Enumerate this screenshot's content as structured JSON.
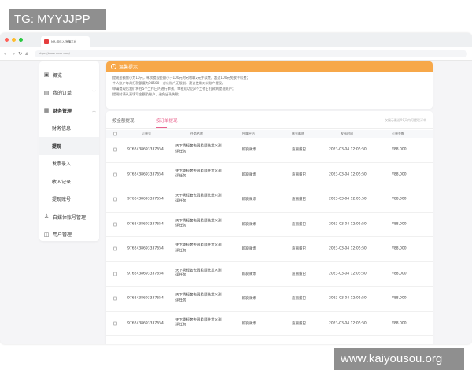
{
  "watermarks": {
    "top": "TG: MYYJJPP",
    "bottom": "www.kaiyousou.org"
  },
  "colors": {
    "accent": "#e8628c",
    "notice": "#f7a84a",
    "close_dot": "#ff5f57",
    "min_dot": "#febc2e",
    "max_dot": "#28c840"
  },
  "browser": {
    "tab_title": "MR-纯讯入·官播平台",
    "url": "https://www.xxxx.com/",
    "nav_icons": [
      "back-icon",
      "forward-icon",
      "reload-icon",
      "home-icon"
    ]
  },
  "sidebar": {
    "items": [
      {
        "label": "概览",
        "icon": "overview-icon"
      },
      {
        "label": "我的订单",
        "icon": "order-icon",
        "chevron": "chevron-down-icon"
      },
      {
        "label": "财务管理",
        "icon": "finance-icon",
        "chevron": "chevron-up-icon"
      }
    ],
    "sub_items": [
      {
        "label": "财务信息"
      },
      {
        "label": "提现"
      },
      {
        "label": "发票录入"
      },
      {
        "label": "收入记录"
      },
      {
        "label": "提现账号"
      }
    ],
    "bottom_items": [
      {
        "label": "自媒体账号管理",
        "icon": "media-icon"
      },
      {
        "label": "用户管理",
        "icon": "user-icon"
      }
    ]
  },
  "notice": {
    "title": "温馨提示",
    "lines": [
      "提现金额需小为10元，单次提现金额小于100元时另收取2元手续费，超过100元免收手续费；",
      "个人账户每月打款额度为98500，对公账户无限制，建议使用对公账户提现。",
      "申请提现后我们将在5个工作日内进行审核，审核成功后3个工作日打款到提现账户；",
      "提现时请认真填写金额及账户，避免出现失败。"
    ]
  },
  "tabs": {
    "items": [
      "按金额提现",
      "按订单提现"
    ],
    "hint": "仅展示最近90天内可提现订单"
  },
  "table": {
    "headers": [
      "订单号",
      "任务名称",
      "所属平台",
      "账号昵称",
      "发布时间",
      "订单金额"
    ],
    "rows": [
      {
        "id": "97624386933376​54",
        "name": "天下秀轻奢去屑柔顺洗发水测评任务",
        "platform": "新浪微博",
        "account": "迪丽董巴",
        "time": "2023-03-04 12:05:50",
        "amount": "¥88,000"
      },
      {
        "id": "9762438693337654",
        "name": "天下秀轻奢去屑柔顺洗发水测评任务",
        "platform": "新浪微博",
        "account": "迪丽董巴",
        "time": "2023-03-04 12:05:50",
        "amount": "¥88,000"
      },
      {
        "id": "9762438693337654",
        "name": "天下秀轻奢去屑柔顺洗发水测评任务",
        "platform": "新浪微博",
        "account": "迪丽董巴",
        "time": "2023-03-04 12:05:50",
        "amount": "¥88,000"
      },
      {
        "id": "9762438693337654",
        "name": "天下秀轻奢去屑柔顺洗发水测评任务",
        "platform": "新浪微博",
        "account": "迪丽董巴",
        "time": "2023-03-04 12:05:50",
        "amount": "¥88,000"
      },
      {
        "id": "9762438693337654",
        "name": "天下秀轻奢去屑柔顺洗发水测评任务",
        "platform": "新浪微博",
        "account": "迪丽董巴",
        "time": "2023-03-04 12:05:50",
        "amount": "¥88,000"
      },
      {
        "id": "9762438693337654",
        "name": "天下秀轻奢去屑柔顺洗发水测评任务",
        "platform": "新浪微博",
        "account": "迪丽董巴",
        "time": "2023-03-04 12:05:50",
        "amount": "¥88,000"
      },
      {
        "id": "9762438693337654",
        "name": "天下秀轻奢去屑柔顺洗发水测评任务",
        "platform": "新浪微博",
        "account": "迪丽董巴",
        "time": "2023-03-04 12:05:50",
        "amount": "¥88,000"
      },
      {
        "id": "9762438693337654",
        "name": "天下秀轻奢去屑柔顺洗发水测评任务",
        "platform": "新浪微博",
        "account": "迪丽董巴",
        "time": "2023-03-04 12:05:50",
        "amount": "¥88,000"
      }
    ]
  }
}
